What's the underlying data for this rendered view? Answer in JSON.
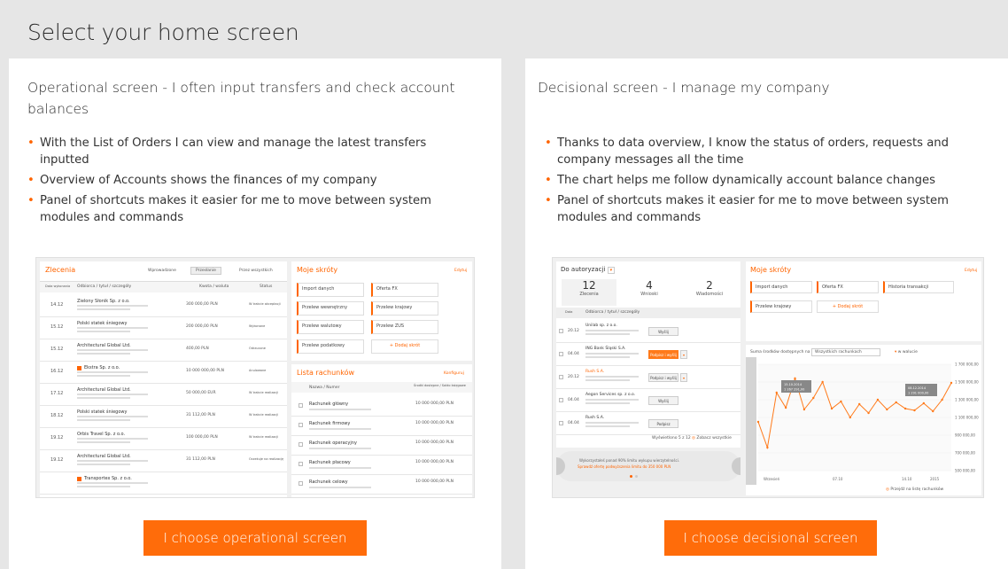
{
  "page_title": "Select your home screen",
  "operational": {
    "title": "Operational screen - I often input transfers and check account balances",
    "bullets": [
      "With the List of Orders I can view and manage the latest transfers inputted",
      "Overview of Accounts shows the finances of my company",
      "Panel of shortcuts makes it easier for me to move between system modules and commands"
    ],
    "button_label": "I choose operational screen",
    "preview": {
      "orders_title": "Zlecenia",
      "tabs": [
        "Wprowadzone",
        "Przesłanie",
        "Przez wszystkich"
      ],
      "col_date": "Data wykonania",
      "col_payee": "Odbiorca / tytuł / szczegóły",
      "col_amount": "Kwota / waluta",
      "col_status": "Status",
      "rows": [
        {
          "date": "14.12",
          "name": "Zielony Słonik Sp. z o.o.",
          "amount": "300 000,00 PLN",
          "status": "W trakcie akceptacji"
        },
        {
          "date": "15.12",
          "name": "Polski statek śniegowy",
          "amount": "200 000,00 PLN",
          "status": "Wykonane"
        },
        {
          "date": "15.12",
          "name": "Architectural Global Ltd.",
          "amount": "400,00 PLN",
          "status": "Odrzucone"
        },
        {
          "date": "16.12",
          "name": "Ekstra Sp. z o.o.",
          "amount": "10 000 000,00 PLN",
          "status": "Anulowane"
        },
        {
          "date": "17.12",
          "name": "Architectural Global Ltd.",
          "amount": "50 000,00 EUR",
          "status": "W trakcie realizacji"
        },
        {
          "date": "18.12",
          "name": "Polski statek śniegowy",
          "amount": "31 112,00 PLN",
          "status": "W trakcie realizacji"
        },
        {
          "date": "19.12",
          "name": "Orbis Travel Sp. z o.o.",
          "amount": "100 000,00 PLN",
          "status": "W trakcie realizacji"
        },
        {
          "date": "19.12",
          "name": "Architectural Global Ltd.",
          "amount": "31 112,00 PLN",
          "status": "Oczekuje na realizację"
        },
        {
          "date": "",
          "name": "Transportex Sp. z o.o.",
          "amount": "",
          "status": ""
        }
      ],
      "shortcuts_title": "Moje skróty",
      "shortcuts_edit": "Edytuj",
      "shortcuts": [
        "Import danych",
        "Oferta FX",
        "Przelew wewnętrzny",
        "Przelew krajowy",
        "Przelew walutowy",
        "Przelew ZUS",
        "Przelew podatkowy",
        "Dodaj skrót"
      ],
      "accounts_title": "Lista rachunków",
      "accounts_link": "Konfiguruj",
      "accounts_col_name": "Nazwa / Numer",
      "accounts_col_funds": "Środki dostępne / Saldo księgowe",
      "accounts": [
        {
          "name": "Rachunek główny",
          "amount": "10 000 000,00 PLN"
        },
        {
          "name": "Rachunek firmowy",
          "amount": "10 000 000,00 PLN"
        },
        {
          "name": "Rachunek operacyjny",
          "amount": "10 000 000,00 PLN"
        },
        {
          "name": "Rachunek płacowy",
          "amount": "10 000 000,00 PLN"
        },
        {
          "name": "Rachunek celowy",
          "amount": "10 000 000,00 PLN"
        }
      ]
    }
  },
  "decisional": {
    "title": "Decisional screen - I manage my company",
    "bullets": [
      "Thanks to data overview, I know the status of orders, requests and company messages all the time",
      "The chart helps me follow dynamically account balance changes",
      "Panel of shortcuts makes it easier for me to move between system modules and commands"
    ],
    "button_label": "I choose decisional screen",
    "preview": {
      "auth_select": "Do autoryzacji",
      "counters": [
        {
          "value": "12",
          "label": "Zlecenia"
        },
        {
          "value": "4",
          "label": "Wnioski"
        },
        {
          "value": "2",
          "label": "Wiadomości"
        }
      ],
      "col_date": "Data",
      "col_payee": "Odbiorca / tytuł / szczegóły",
      "rows": [
        {
          "date": "20.12",
          "name": "Unilab sp. z o.o.",
          "action": "Wyślij"
        },
        {
          "date": "04.04",
          "name": "ING Bank Śląski S.A.",
          "action": "Podpisz i wyślij"
        },
        {
          "date": "20.12",
          "name": "Rush S.A.",
          "action": "Podpisz i wyślij"
        },
        {
          "date": "04.04",
          "name": "Aegon Services sp. z o.o.",
          "action": "Wyślij"
        },
        {
          "date": "04.04",
          "name": "Rush S.A.",
          "action": "Podpisz"
        }
      ],
      "shown_label": "Wyświetlono 5 z 12",
      "show_all": "Zobacz wszystkie",
      "promo_line1": "Wykorzystałeś ponad 90% limitu wykupu wierzytelności.",
      "promo_line2": "Sprawdź ofertę podwyższenia limitu do 350 000 PLN",
      "shortcuts_title": "Moje skróty",
      "shortcuts_edit": "Edytuj",
      "shortcuts": [
        "Import danych",
        "Oferta FX",
        "Historia transakcji",
        "Przelew krajowy",
        "Dodaj skrót"
      ],
      "chart_select_label": "Suma środków dostępnych na",
      "chart_select": "Wszystkich rachunkach",
      "chart_currency": "w walucie",
      "y_ticks": [
        "1 700 000,00",
        "1 500 000,00",
        "1 300 000,00",
        "1 100 000,00",
        "900 000,00",
        "700 000,00",
        "500 000,00"
      ],
      "x_ticks": [
        "Wrzesień",
        "07.10",
        "14.10",
        "2015"
      ],
      "tooltip1_date": "15.10.2014",
      "tooltip1_value": "1 267 291,00",
      "tooltip2_date": "08.12.2014",
      "tooltip2_value": "1 291 000,00",
      "accounts_link": "Przejdź na listę rachunków"
    }
  },
  "chart_data": {
    "type": "line",
    "x": [
      1,
      2,
      3,
      4,
      5,
      6,
      7,
      8,
      9,
      10,
      11,
      12,
      13,
      14,
      15,
      16,
      17,
      18,
      19,
      20,
      21,
      22
    ],
    "values": [
      1050000,
      760000,
      1380000,
      1210000,
      1540000,
      1190000,
      1320000,
      1500000,
      1200000,
      1280000,
      1100000,
      1250000,
      1150000,
      1300000,
      1190000,
      1270000,
      1200000,
      1180000,
      1260000,
      1170000,
      1300000,
      1490000
    ],
    "ylim": [
      500000,
      1700000
    ],
    "color": "#ff7a1a"
  }
}
